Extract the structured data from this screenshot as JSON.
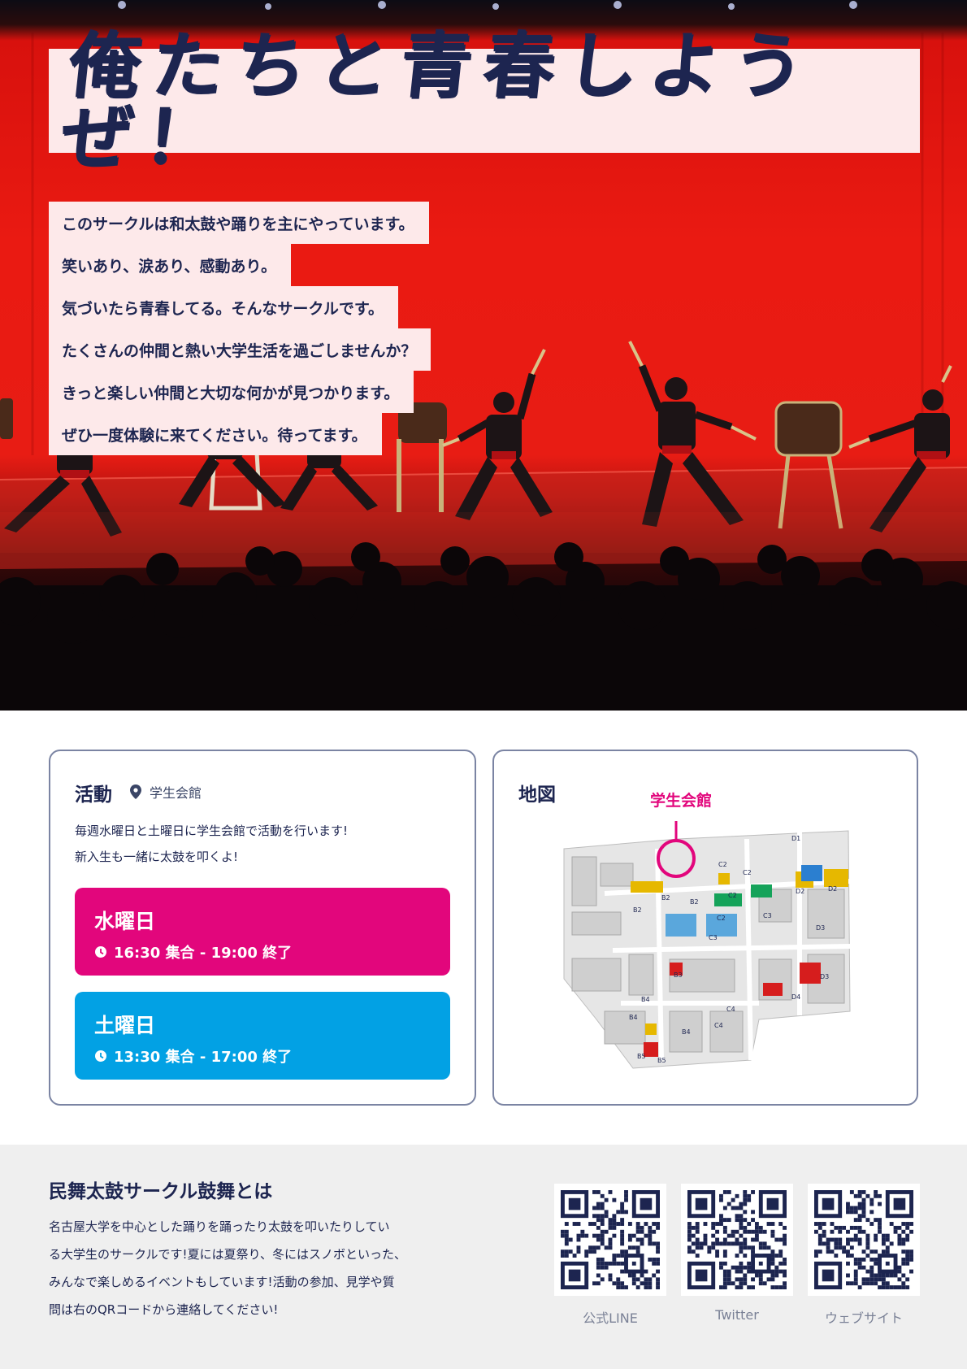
{
  "hero": {
    "headline": "俺たちと青春しようぜ！",
    "intro_lines": [
      "このサークルは和太鼓や踊りを主にやっています。",
      "笑いあり、涙あり、感動あり。",
      "気づいたら青春してる。そんなサークルです。",
      "たくさんの仲間と熱い大学生活を過ごしませんか？",
      "きっと楽しい仲間と大切な何かが見つかります。",
      "ぜひ一度体験に来てください。待ってます。"
    ]
  },
  "activity": {
    "title": "活動",
    "location": "学生会館",
    "description_lines": [
      "毎週水曜日と土曜日に学生会館で活動を行います!",
      "新入生も一緒に太鼓を叩くよ!"
    ],
    "schedule": [
      {
        "day": "水曜日",
        "time": "16:30 集合 - 19:00 終了",
        "color": "#e2067c"
      },
      {
        "day": "土曜日",
        "time": "13:30 集合 - 17:00 終了",
        "color": "#02a1e4"
      }
    ]
  },
  "map": {
    "title": "地図",
    "highlight_label": "学生会館",
    "marker_color": "#e2067c"
  },
  "about": {
    "title": "民舞太鼓サークル鼓舞とは",
    "body_lines": [
      "名古屋大学を中心とした踊りを踊ったり太鼓を叩いたりしてい",
      "る大学生のサークルです!夏には夏祭り、冬にはスノボといった、",
      "みんなで楽しめるイベントもしています!活動の参加、見学や質",
      "問は右のQRコードから連絡してください!"
    ]
  },
  "qr_codes": [
    {
      "label": "公式LINE",
      "icon": "qr-code"
    },
    {
      "label": "Twitter",
      "icon": "qr-code"
    },
    {
      "label": "ウェブサイト",
      "icon": "qr-code"
    }
  ],
  "colors": {
    "navy": "#1d2550",
    "magenta": "#e2067c",
    "cyan": "#02a1e4",
    "stage_red": "#e81c14",
    "band_pink": "#fde9ea"
  }
}
